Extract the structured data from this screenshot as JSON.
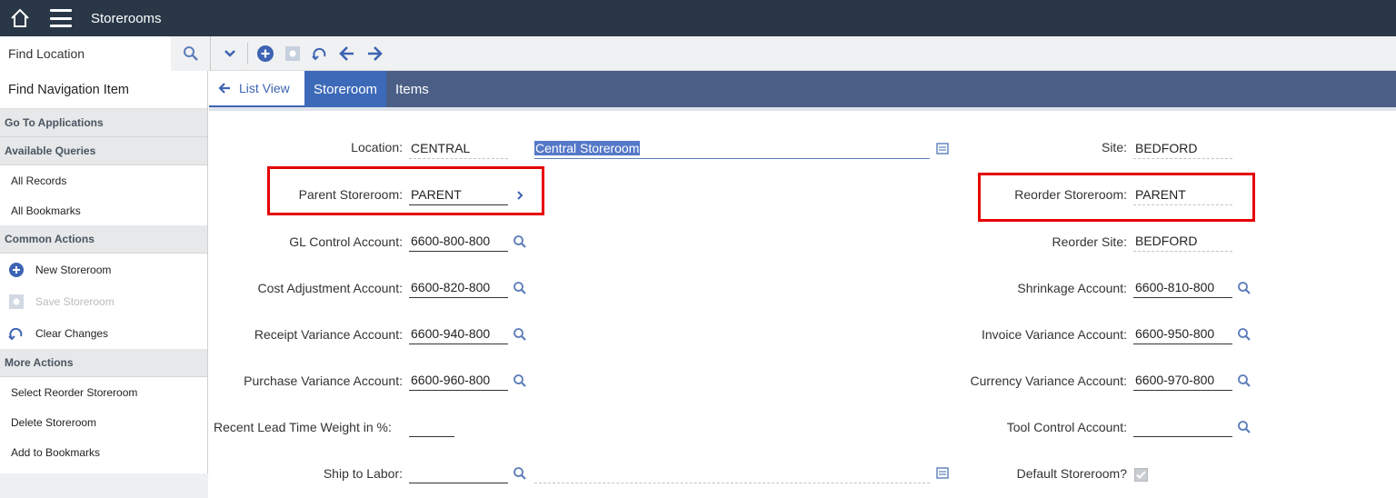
{
  "app": {
    "title": "Storerooms"
  },
  "toolbar": {
    "find_location_placeholder": "Find Location"
  },
  "leftnav": {
    "find_nav_label": "Find Navigation Item",
    "sections": {
      "go_to_apps": "Go To Applications",
      "available_queries": "Available Queries",
      "common_actions": "Common Actions",
      "more_actions": "More Actions"
    },
    "queries": [
      "All Records",
      "All Bookmarks"
    ],
    "common": [
      "New Storeroom",
      "Save Storeroom",
      "Clear Changes"
    ],
    "more": [
      "Select Reorder Storeroom",
      "Delete Storeroom",
      "Add to Bookmarks"
    ]
  },
  "tabs": {
    "list_view": "List View",
    "storeroom": "Storeroom",
    "items": "Items"
  },
  "form": {
    "location": {
      "label": "Location:",
      "value": "CENTRAL",
      "description": "Central Storeroom"
    },
    "site": {
      "label": "Site:",
      "value": "BEDFORD"
    },
    "parent_storeroom": {
      "label": "Parent Storeroom:",
      "value": "PARENT"
    },
    "reorder_storeroom": {
      "label": "Reorder Storeroom:",
      "value": "PARENT"
    },
    "gl_control": {
      "label": "GL Control Account:",
      "value": "6600-800-800"
    },
    "reorder_site": {
      "label": "Reorder Site:",
      "value": "BEDFORD"
    },
    "cost_adjustment": {
      "label": "Cost Adjustment Account:",
      "value": "6600-820-800"
    },
    "shrinkage": {
      "label": "Shrinkage Account:",
      "value": "6600-810-800"
    },
    "receipt_variance": {
      "label": "Receipt Variance Account:",
      "value": "6600-940-800"
    },
    "invoice_variance": {
      "label": "Invoice Variance Account:",
      "value": "6600-950-800"
    },
    "purchase_variance": {
      "label": "Purchase Variance Account:",
      "value": "6600-960-800"
    },
    "currency_variance": {
      "label": "Currency Variance Account:",
      "value": "6600-970-800"
    },
    "lead_time_weight": {
      "label": "Recent Lead Time Weight in %:",
      "value": ""
    },
    "tool_control": {
      "label": "Tool Control Account:",
      "value": ""
    },
    "ship_to_labor": {
      "label": "Ship to Labor:",
      "value": ""
    },
    "default_storeroom": {
      "label": "Default Storeroom?",
      "checked": true
    }
  },
  "colors": {
    "header_bg": "#293747",
    "tab_bar": "#4b5f86",
    "tab_active": "#3d6ab8",
    "accent": "#3d64b4",
    "highlight_box": "#e60000"
  }
}
